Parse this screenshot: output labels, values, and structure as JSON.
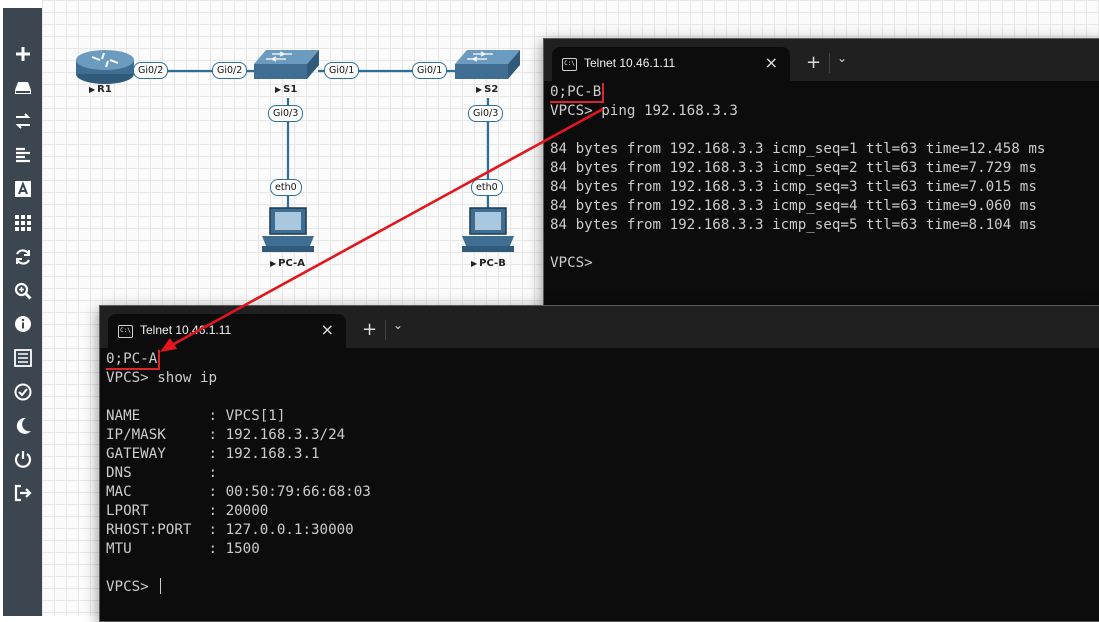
{
  "toolbar": {
    "items": [
      {
        "icon": "plus-icon",
        "glyph": "+"
      },
      {
        "icon": "drive-icon",
        "glyph": ""
      },
      {
        "icon": "transfer-arrows-icon",
        "glyph": "⇄"
      },
      {
        "icon": "align-left-icon",
        "glyph": "≡"
      },
      {
        "icon": "text-box-icon",
        "glyph": "A"
      },
      {
        "icon": "grid-icon",
        "glyph": "▦"
      },
      {
        "icon": "refresh-icon",
        "glyph": "↻"
      },
      {
        "icon": "zoom-icon",
        "glyph": "⊕"
      },
      {
        "icon": "info-icon",
        "glyph": "ⓘ"
      },
      {
        "icon": "list-icon",
        "glyph": "☰"
      },
      {
        "icon": "check-circle-icon",
        "glyph": "✓"
      },
      {
        "icon": "moon-icon",
        "glyph": "☾"
      },
      {
        "icon": "power-icon",
        "glyph": "⏻"
      },
      {
        "icon": "logout-icon",
        "glyph": "⇥"
      }
    ]
  },
  "topology": {
    "nodes": {
      "r1": "R1",
      "s1": "S1",
      "s2": "S2",
      "pca": "PC-A",
      "pcb": "PC-B"
    },
    "ports": {
      "r1_gi02": "Gi0/2",
      "s1_gi02": "Gi0/2",
      "s1_gi01": "Gi0/1",
      "s2_gi01": "Gi0/1",
      "s1_gi03": "Gi0/3",
      "s2_gi03": "Gi0/3",
      "pca_eth0": "eth0",
      "pcb_eth0": "eth0"
    },
    "colors": {
      "link": "#2d6f9c",
      "device": "#3f6e92",
      "annotation": "#e3151d"
    }
  },
  "terminal_b": {
    "tab_title": "Telnet 10.46.1.11",
    "lines": [
      "0;PC-B",
      "VPCS> ping 192.168.3.3",
      "",
      "84 bytes from 192.168.3.3 icmp_seq=1 ttl=63 time=12.458 ms",
      "84 bytes from 192.168.3.3 icmp_seq=2 ttl=63 time=7.729 ms",
      "84 bytes from 192.168.3.3 icmp_seq=3 ttl=63 time=7.015 ms",
      "84 bytes from 192.168.3.3 icmp_seq=4 ttl=63 time=9.060 ms",
      "84 bytes from 192.168.3.3 icmp_seq=5 ttl=63 time=8.104 ms",
      "",
      "VPCS>"
    ]
  },
  "terminal_a": {
    "tab_title": "Telnet 10.46.1.11",
    "lines": [
      "0;PC-A",
      "VPCS> show ip",
      "",
      "NAME        : VPCS[1]",
      "IP/MASK     : 192.168.3.3/24",
      "GATEWAY     : 192.168.3.1",
      "DNS         :",
      "MAC         : 00:50:79:66:68:03",
      "LPORT       : 20000",
      "RHOST:PORT  : 127.0.0.1:30000",
      "MTU         : 1500",
      "",
      "VPCS> "
    ]
  }
}
